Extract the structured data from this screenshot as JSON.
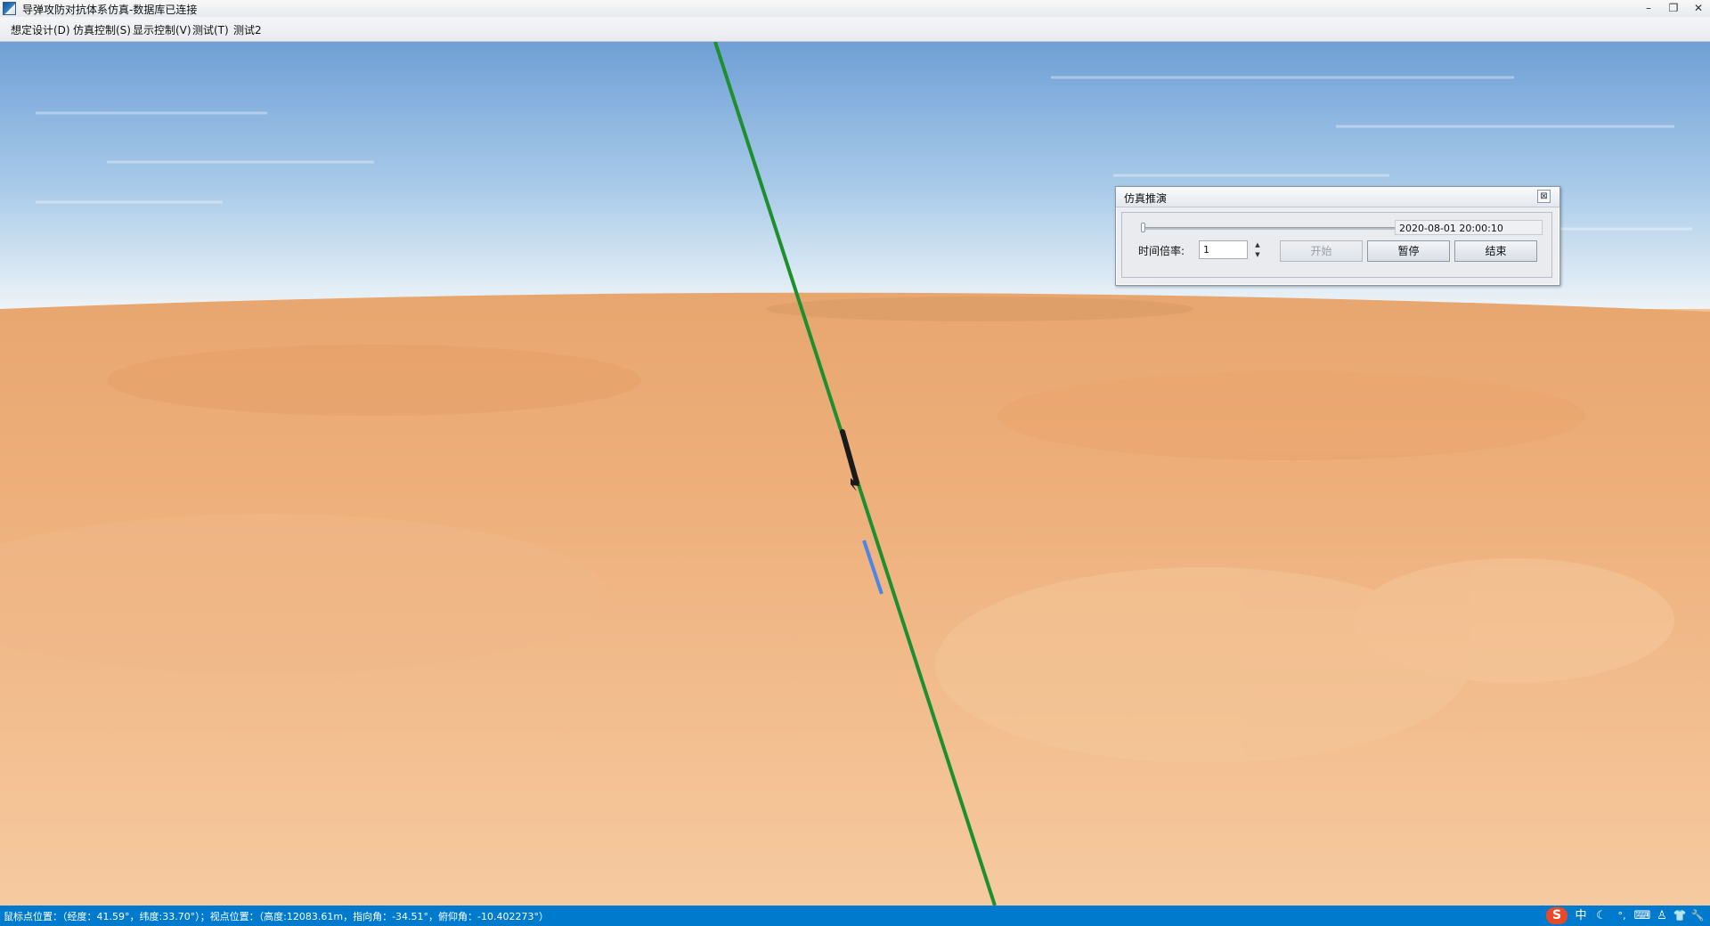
{
  "window": {
    "title": "导弹攻防对抗体系仿真-数据库已连接",
    "minimize_glyph": "–",
    "restore_glyph": "❐",
    "close_glyph": "✕"
  },
  "menu": {
    "items": [
      {
        "label": "想定设计(D)"
      },
      {
        "label": "仿真控制(S)"
      },
      {
        "label": "显示控制(V)"
      },
      {
        "label": "测试(T)"
      },
      {
        "label": "测试2"
      }
    ]
  },
  "viewport": {
    "trajectory_color": "#1d8f2e",
    "missile_color": "#1a1a1a",
    "trail_color": "#4a86e8",
    "sky_top": "#6f9fd6",
    "sky_horizon": "#eef4f8",
    "terrain_far": "#e8a66f",
    "terrain_near": "#f6caa0"
  },
  "sim_dialog": {
    "title": "仿真推演",
    "close_glyph": "⊠",
    "slider_value": 0,
    "datetime": "2020-08-01 20:00:10",
    "rate_label": "时间倍率:",
    "rate_value": "1",
    "spin_up": "▲",
    "spin_down": "▼",
    "start_label": "开始",
    "pause_label": "暂停",
    "end_label": "结束"
  },
  "status": {
    "text": "鼠标点位置：（经度：41.59°，纬度:33.70°）；视点位置：（高度:12083.61m，指向角：-34.51°，俯仰角：-10.402273°）",
    "bg_color": "#007acc",
    "tray": [
      {
        "name": "sogou-ime-icon",
        "glyph": "S"
      },
      {
        "name": "chinese-mode-icon",
        "glyph": "中"
      },
      {
        "name": "moon-icon",
        "glyph": "☾"
      },
      {
        "name": "punctuation-icon",
        "glyph": "°,"
      },
      {
        "name": "keyboard-icon",
        "glyph": "⌨"
      },
      {
        "name": "user-icon",
        "glyph": "♙"
      },
      {
        "name": "shirt-icon",
        "glyph": "👕"
      },
      {
        "name": "wrench-icon",
        "glyph": "🔧"
      }
    ]
  }
}
